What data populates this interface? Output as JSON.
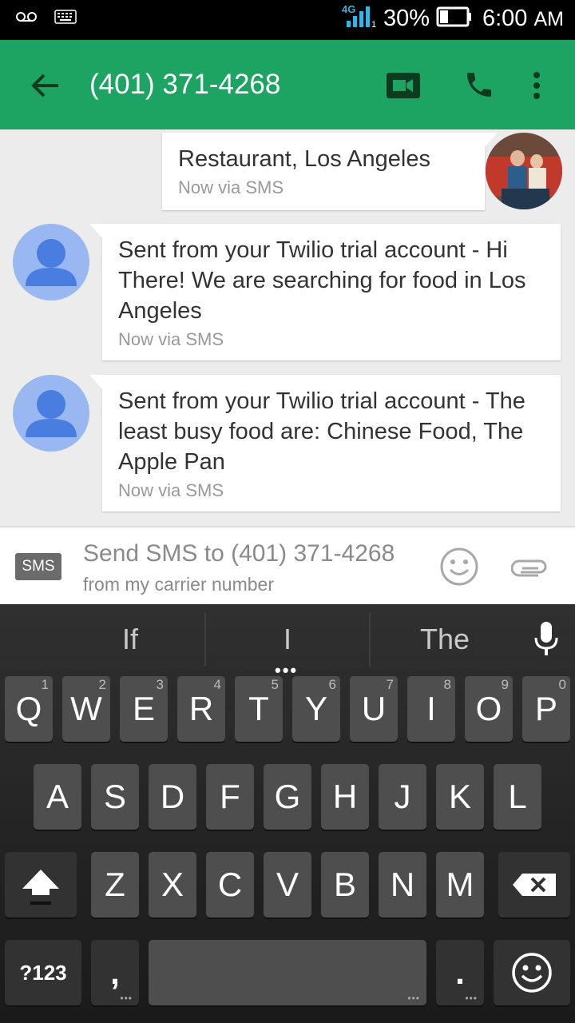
{
  "status_bar": {
    "network": "4G",
    "battery": "30%",
    "time": "6:00",
    "ampm": "AM"
  },
  "app_bar": {
    "title": "(401) 371-4268"
  },
  "messages": [
    {
      "direction": "outgoing",
      "text": "Restaurant, Los Angeles",
      "meta": "Now via SMS"
    },
    {
      "direction": "incoming",
      "text": "Sent from your Twilio trial account - Hi There! We are searching for food in Los Angeles",
      "meta": "Now via SMS"
    },
    {
      "direction": "incoming",
      "text": "Sent from your Twilio trial account - The least busy food are: Chinese Food, The Apple Pan",
      "meta": "Now via SMS"
    }
  ],
  "compose": {
    "badge": "SMS",
    "placeholder": "Send SMS to (401) 371-4268",
    "subtext": "from my carrier number"
  },
  "keyboard": {
    "suggestions": [
      "If",
      "I",
      "The"
    ],
    "row1": [
      {
        "label": "Q",
        "hint": "1"
      },
      {
        "label": "W",
        "hint": "2"
      },
      {
        "label": "E",
        "hint": "3"
      },
      {
        "label": "R",
        "hint": "4"
      },
      {
        "label": "T",
        "hint": "5"
      },
      {
        "label": "Y",
        "hint": "6"
      },
      {
        "label": "U",
        "hint": "7"
      },
      {
        "label": "I",
        "hint": "8"
      },
      {
        "label": "O",
        "hint": "9"
      },
      {
        "label": "P",
        "hint": "0"
      }
    ],
    "row2": [
      "A",
      "S",
      "D",
      "F",
      "G",
      "H",
      "J",
      "K",
      "L"
    ],
    "row3": [
      "Z",
      "X",
      "C",
      "V",
      "B",
      "N",
      "M"
    ],
    "symbols_label": "?123",
    "comma_label": ",",
    "period_label": "."
  },
  "colors": {
    "app_bar": "#1da462",
    "icon_dark": "#0d3b20",
    "avatar_generic": "#99b8f2",
    "avatar_figure": "#4a7de0"
  }
}
